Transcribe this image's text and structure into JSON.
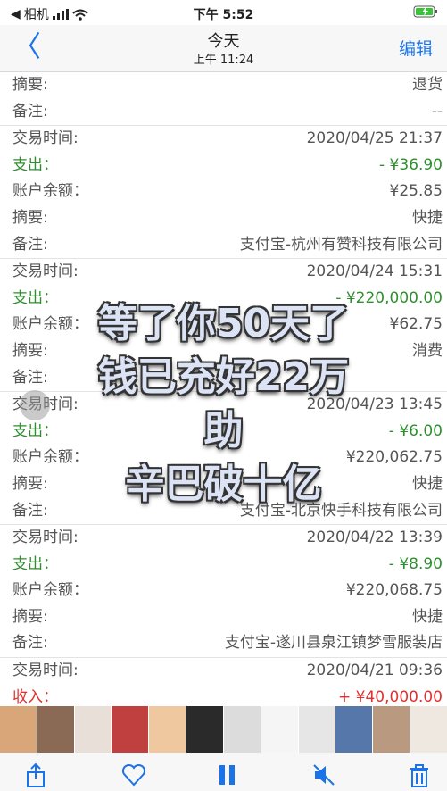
{
  "status": {
    "carrier": "相机",
    "time": "下午 5:52"
  },
  "nav": {
    "back": "〈",
    "title": "今天",
    "subtitle": "上午 11:24",
    "edit": "编辑"
  },
  "entries": [
    {
      "rows": [
        {
          "k": "摘要:",
          "v": "退货"
        },
        {
          "k": "备注:",
          "v": "--"
        }
      ]
    },
    {
      "rows": [
        {
          "k": "交易时间:",
          "v": "2020/04/25 21:37"
        },
        {
          "k": "支出：",
          "v": "- ¥36.90",
          "t": "out"
        },
        {
          "k": "账户余额：",
          "v": "¥25.85"
        },
        {
          "k": "摘要:",
          "v": "快捷"
        },
        {
          "k": "备注:",
          "v": "支付宝-杭州有赞科技有限公司"
        }
      ]
    },
    {
      "rows": [
        {
          "k": "交易时间:",
          "v": "2020/04/24 15:31"
        },
        {
          "k": "支出：",
          "v": "- ¥220,000.00",
          "t": "out"
        },
        {
          "k": "账户余额：",
          "v": "¥62.75"
        },
        {
          "k": "摘要:",
          "v": "消费"
        },
        {
          "k": "备注:",
          "v": ""
        }
      ]
    },
    {
      "rows": [
        {
          "k": "交易时间:",
          "v": "2020/04/23 13:45"
        },
        {
          "k": "支出：",
          "v": "- ¥6.00",
          "t": "out"
        },
        {
          "k": "账户余额：",
          "v": "¥220,062.75"
        },
        {
          "k": "摘要:",
          "v": "快捷"
        },
        {
          "k": "备注:",
          "v": "支付宝-北京快手科技有限公司"
        }
      ]
    },
    {
      "rows": [
        {
          "k": "交易时间:",
          "v": "2020/04/22 13:39"
        },
        {
          "k": "支出：",
          "v": "- ¥8.90",
          "t": "out"
        },
        {
          "k": "账户余额：",
          "v": "¥220,068.75"
        },
        {
          "k": "摘要:",
          "v": "快捷"
        },
        {
          "k": "备注:",
          "v": "支付宝-遂川县泉江镇梦雪服装店"
        }
      ]
    },
    {
      "rows": [
        {
          "k": "交易时间:",
          "v": "2020/04/21 09:36"
        },
        {
          "k": "收入：",
          "v": "+ ¥40,000.00",
          "t": "in"
        }
      ]
    }
  ],
  "overlay": {
    "line1": "等了你50天了",
    "line2": "钱已充好22万",
    "line3": "助",
    "line4": "辛巴破十亿"
  },
  "thumb_colors": [
    "#d9a679",
    "#8a6a55",
    "#e8e0d8",
    "#c04040",
    "#f0c8a0",
    "#2a2a2a",
    "#dcdcdc",
    "#f5f5f5",
    "#e6e6e6",
    "#5577aa",
    "#b99a80",
    "#efe8e0"
  ]
}
